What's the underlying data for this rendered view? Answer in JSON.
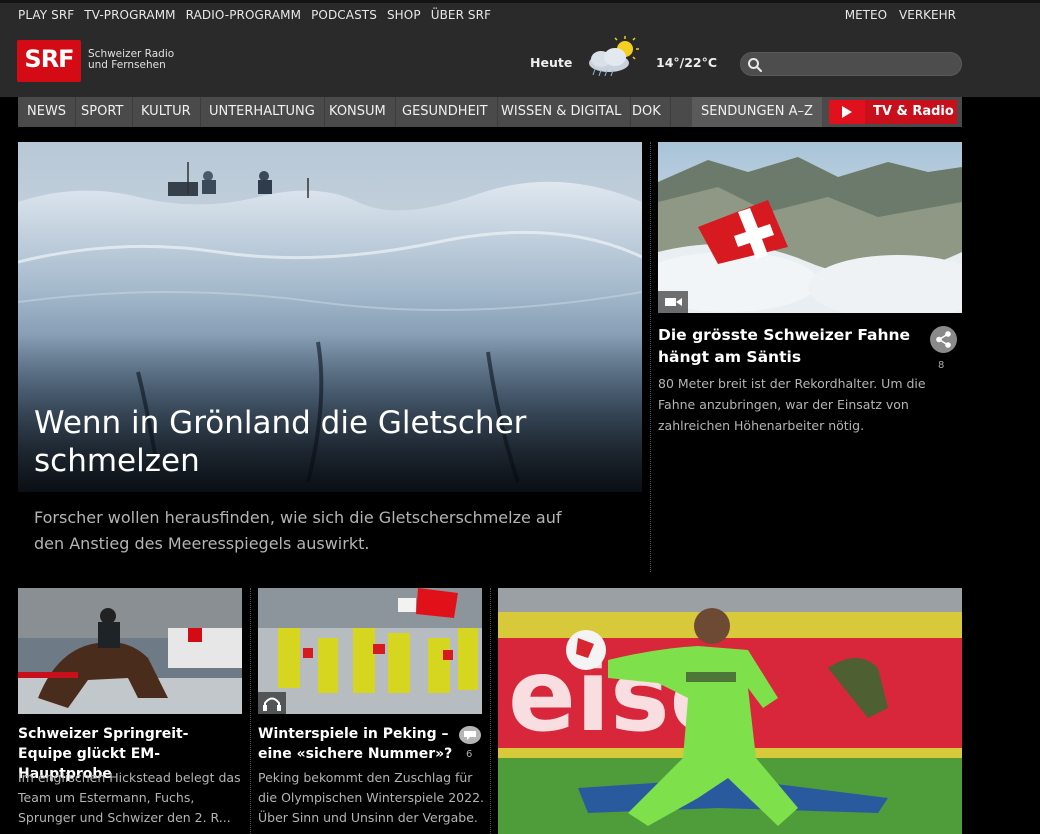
{
  "util_nav": [
    "PLAY SRF",
    "TV-PROGRAMM",
    "RADIO-PROGRAMM",
    "PODCASTS",
    "SHOP",
    "ÜBER SRF"
  ],
  "util_right": [
    "METEO",
    "VERKEHR"
  ],
  "logo": {
    "text": "SRF",
    "subtitle": "Schweizer Radio\nund Fernsehen",
    "color": "#d40a14"
  },
  "weather": {
    "label": "Heute",
    "icon": "sun-cloud-icon",
    "temp": "14°/22°C"
  },
  "search": {
    "placeholder": "",
    "value": ""
  },
  "main_nav": [
    {
      "label": "NEWS"
    },
    {
      "label": "SPORT"
    },
    {
      "label": "KULTUR"
    },
    {
      "label": "UNTERHALTUNG"
    },
    {
      "label": "KONSUM"
    },
    {
      "label": "GESUNDHEIT"
    },
    {
      "label": "WISSEN & DIGITAL"
    },
    {
      "label": "DOK"
    }
  ],
  "sendungen": "SENDUNGEN A–Z",
  "tvradio": {
    "label": "TV & Radio",
    "color": "#c8101c"
  },
  "hero": {
    "title": "Wenn in Grönland die Gletscher schmelzen",
    "lead": "Forscher wollen herausfinden, wie sich die Gletscherschmelze auf den Anstieg des Meeresspiegels auswirkt."
  },
  "side_teaser": {
    "title": "Die grösste Schweizer Fahne hängt am Säntis",
    "text": "80 Meter breit ist der Rekordhalter. Um die Fahne anzubringen, war der Einsatz von zahlreichen Höhenarbeiter nötig.",
    "share_count": "8",
    "media": "video-icon"
  },
  "cards": [
    {
      "title": "Schweizer Springreit-Equipe glückt EM-Hauptprobe",
      "text": "Im englischen Hickstead belegt das Team um Estermann, Fuchs, Sprunger und Schwizer den 2. R..."
    },
    {
      "title": "Winterspiele in Peking – eine «sichere Nummer»?",
      "text": "Peking bekommt den Zuschlag für die Olympischen Winterspiele 2022. Über Sinn und Unsinn der Vergabe.",
      "comment_count": "6",
      "media": "headphones-icon"
    }
  ]
}
